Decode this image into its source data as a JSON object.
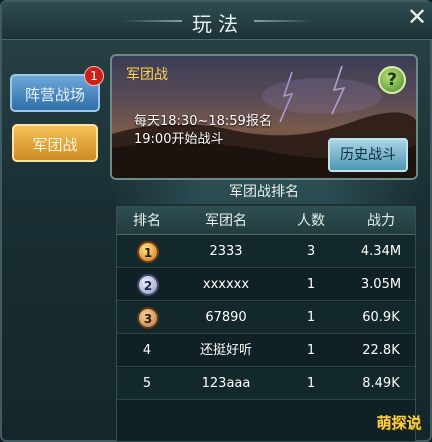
{
  "window": {
    "title": "玩法",
    "close_glyph": "✕"
  },
  "tabs": [
    {
      "label": "阵营战场",
      "badge": "1"
    },
    {
      "label": "军团战"
    }
  ],
  "banner": {
    "label": "军团战",
    "help_glyph": "?",
    "schedule_line1": "每天18:30~18:59报名",
    "schedule_line2": "19:00开始战斗",
    "history_button": "历史战斗"
  },
  "ranking": {
    "title": "军团战排名",
    "columns": [
      "排名",
      "军团名",
      "人数",
      "战力"
    ],
    "rows": [
      {
        "rank": "1",
        "name": "2333",
        "members": "3",
        "power": "4.34M"
      },
      {
        "rank": "2",
        "name": "xxxxxx",
        "members": "1",
        "power": "3.05M"
      },
      {
        "rank": "3",
        "name": "67890",
        "members": "1",
        "power": "60.9K"
      },
      {
        "rank": "4",
        "name": "还挺好听",
        "members": "1",
        "power": "22.8K"
      },
      {
        "rank": "5",
        "name": "123aaa",
        "members": "1",
        "power": "8.49K"
      }
    ]
  },
  "watermark": "萌探说",
  "colors": {
    "accent_gold": "#ffd34d",
    "tab_active": "#d08a22",
    "tab_camp": "#2f6ea7"
  }
}
